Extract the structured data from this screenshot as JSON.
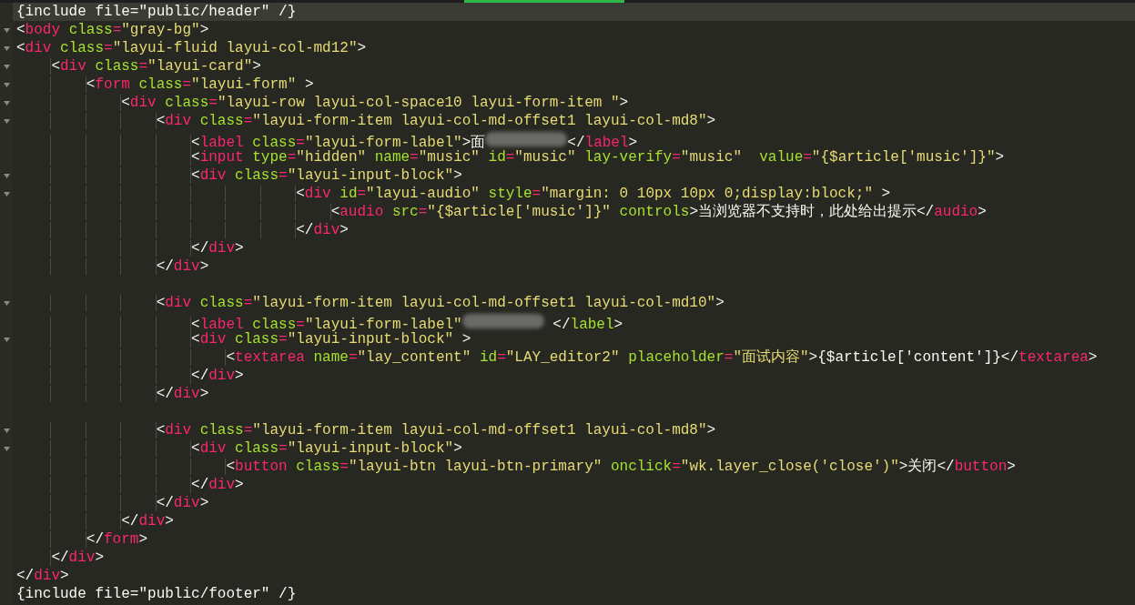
{
  "editor": {
    "lines": [
      {
        "fold": false,
        "current": true,
        "parts": [
          "{include file=\"public/header\" /}"
        ]
      },
      {
        "fold": true,
        "current": false,
        "parts": [
          "<body class=\"gray-bg\">"
        ]
      },
      {
        "fold": true,
        "current": false,
        "parts": [
          "<div class=\"layui-fluid layui-col-md12\">"
        ]
      },
      {
        "fold": true,
        "current": false,
        "parts": [
          "    <div class=\"layui-card\">"
        ]
      },
      {
        "fold": true,
        "current": false,
        "parts": [
          "        <form class=\"layui-form\" >"
        ]
      },
      {
        "fold": true,
        "current": false,
        "parts": [
          "            <div class=\"layui-row layui-col-space10 layui-form-item \">"
        ]
      },
      {
        "fold": true,
        "current": false,
        "parts": [
          "                <div class=\"layui-form-item layui-col-md-offset1 layui-col-md8\">"
        ]
      },
      {
        "fold": false,
        "current": false,
        "parts": [
          "                    <label class=\"layui-form-label\">面",
          "</label>"
        ]
      },
      {
        "fold": false,
        "current": false,
        "parts": [
          "                    <input type=\"hidden\" name=\"music\" id=\"music\" lay-verify=\"music\"  value=\"{$article['music']}\">"
        ]
      },
      {
        "fold": true,
        "current": false,
        "parts": [
          "                    <div class=\"layui-input-block\">"
        ]
      },
      {
        "fold": true,
        "current": false,
        "parts": [
          "                                <div id=\"layui-audio\" style=\"margin: 0 10px 10px 0;display:block;\" >"
        ]
      },
      {
        "fold": false,
        "current": false,
        "parts": [
          "                                    <audio src=\"{$article['music']}\" controls>当浏览器不支持时，此处给出提示</audio>"
        ]
      },
      {
        "fold": false,
        "current": false,
        "parts": [
          "                                </div>"
        ]
      },
      {
        "fold": false,
        "current": false,
        "parts": [
          "                    </div>"
        ]
      },
      {
        "fold": false,
        "current": false,
        "parts": [
          "                </div>"
        ]
      },
      {
        "fold": false,
        "current": false
      },
      {
        "fold": true,
        "current": false,
        "parts": [
          "                <div class=\"layui-form-item layui-col-md-offset1 layui-col-md10\">"
        ]
      },
      {
        "fold": false,
        "current": false,
        "parts": [
          "                    <label class=\"layui-form-label\"",
          " </label>"
        ]
      },
      {
        "fold": true,
        "current": false,
        "parts": [
          "                    <div class=\"layui-input-block\" >"
        ]
      },
      {
        "fold": false,
        "current": false,
        "parts": [
          "                        <textarea name=\"lay_content\" id=\"LAY_editor2\" placeholder=\"面试内容\">{$article['content']}</textarea>"
        ]
      },
      {
        "fold": false,
        "current": false,
        "parts": [
          "                    </div>"
        ]
      },
      {
        "fold": false,
        "current": false,
        "parts": [
          "                </div>"
        ]
      },
      {
        "fold": false,
        "current": false
      },
      {
        "fold": true,
        "current": false,
        "parts": [
          "                <div class=\"layui-form-item layui-col-md-offset1 layui-col-md8\">"
        ]
      },
      {
        "fold": true,
        "current": false,
        "parts": [
          "                    <div class=\"layui-input-block\">"
        ]
      },
      {
        "fold": false,
        "current": false,
        "parts": [
          "                        <button class=\"layui-btn layui-btn-primary\" onclick=\"wk.layer_close('close')\">关闭</button>"
        ]
      },
      {
        "fold": false,
        "current": false,
        "parts": [
          "                    </div>"
        ]
      },
      {
        "fold": false,
        "current": false,
        "parts": [
          "                </div>"
        ]
      },
      {
        "fold": false,
        "current": false,
        "parts": [
          "            </div>"
        ]
      },
      {
        "fold": false,
        "current": false,
        "parts": [
          "        </form>"
        ]
      },
      {
        "fold": false,
        "current": false,
        "parts": [
          "    </div>"
        ]
      },
      {
        "fold": false,
        "current": false,
        "parts": [
          "</div>"
        ]
      },
      {
        "fold": false,
        "current": false,
        "parts": [
          "{include file=\"public/footer\" /}"
        ]
      }
    ]
  }
}
